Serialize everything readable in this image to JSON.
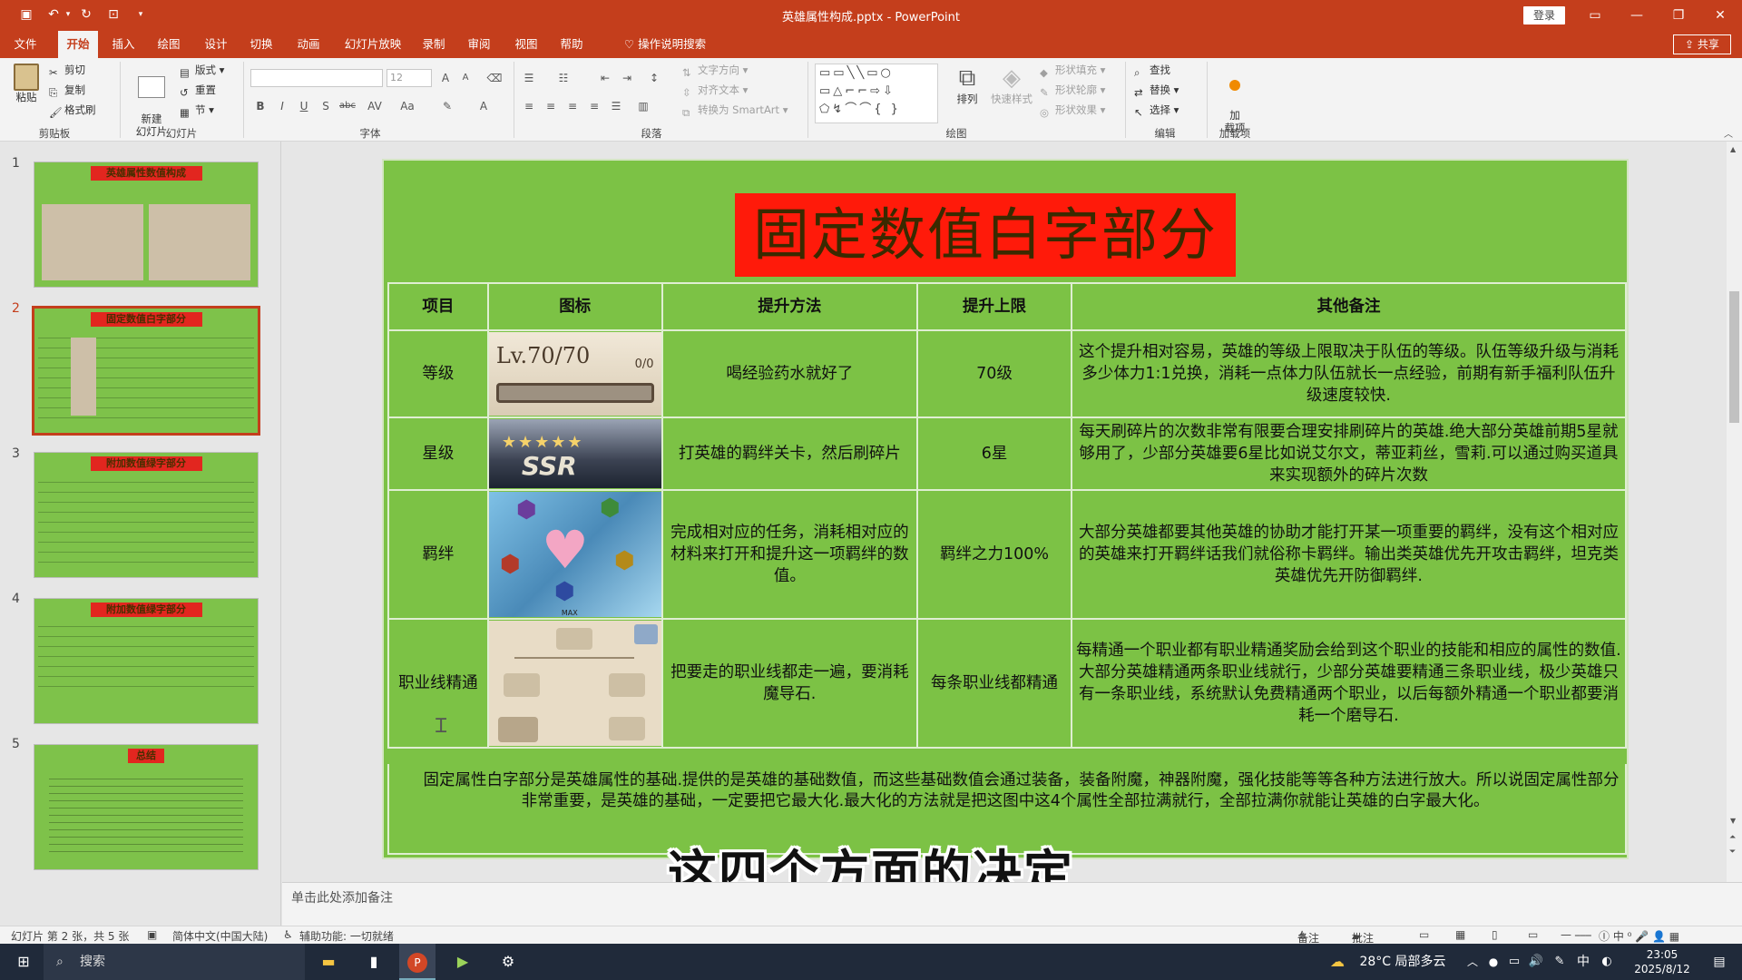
{
  "window": {
    "title": "英雄属性构成.pptx  -  PowerPoint",
    "login_label": "登录",
    "share_label": "共享"
  },
  "tabs": [
    "文件",
    "开始",
    "插入",
    "绘图",
    "设计",
    "切换",
    "动画",
    "幻灯片放映",
    "录制",
    "审阅",
    "视图",
    "帮助"
  ],
  "tell_me": "操作说明搜索",
  "ribbon": {
    "clipboard": {
      "label": "剪贴板",
      "paste": "粘贴",
      "cut": "剪切",
      "copy": "复制",
      "format_painter": "格式刷"
    },
    "slides": {
      "label": "幻灯片",
      "new_slide": "新建\n幻灯片",
      "layout": "版式",
      "reset": "重置",
      "section": "节"
    },
    "font": {
      "label": "字体",
      "size": "12"
    },
    "paragraph": {
      "label": "段落",
      "text_direction": "文字方向",
      "align_text": "对齐文本",
      "smartart": "转换为 SmartArt"
    },
    "drawing": {
      "label": "绘图",
      "arrange": "排列",
      "quick_styles": "快速样式",
      "shape_fill": "形状填充",
      "shape_outline": "形状轮廓",
      "shape_effects": "形状效果"
    },
    "editing": {
      "label": "编辑",
      "find": "查找",
      "replace": "替换",
      "select": "选择"
    },
    "addins": {
      "label": "加载项",
      "button": "加\n载项"
    }
  },
  "thumbnails": [
    {
      "num": "1",
      "title": "英雄属性数值构成"
    },
    {
      "num": "2",
      "title": "固定数值白字部分"
    },
    {
      "num": "3",
      "title": "附加数值绿字部分"
    },
    {
      "num": "4",
      "title": "附加数值绿字部分"
    },
    {
      "num": "5",
      "title": "总结"
    }
  ],
  "slide": {
    "title": "固定数值白字部分",
    "headers": [
      "项目",
      "图标",
      "提升方法",
      "提升上限",
      "其他备注"
    ],
    "rows": [
      {
        "item": "等级",
        "icon_text": "Lv.70/70",
        "icon_sub": "0/0",
        "method": "喝经验药水就好了",
        "limit": "70级",
        "note": "这个提升相对容易，英雄的等级上限取决于队伍的等级。队伍等级升级与消耗多少体力1:1兑换，消耗一点体力队伍就长一点经验，前期有新手福利队伍升级速度较快."
      },
      {
        "item": "星级",
        "icon_text": "SSR",
        "method": "打英雄的羁绊关卡，然后刷碎片",
        "limit": "6星",
        "note": "每天刷碎片的次数非常有限要合理安排刷碎片的英雄.绝大部分英雄前期5星就够用了，少部分英雄要6星比如说艾尔文，蒂亚莉丝，雪莉.可以通过购买道具来实现额外的碎片次数"
      },
      {
        "item": "羁绊",
        "icon_text": "MAX",
        "method": "完成相对应的任务，消耗相对应的材料来打开和提升这一项羁绊的数值。",
        "limit": "羁绊之力100%",
        "note": "大部分英雄都要其他英雄的协助才能打开某一项重要的羁绊，没有这个相对应的英雄来打开羁绊话我们就俗称卡羁绊。输出类英雄优先开攻击羁绊，坦克类英雄优先开防御羁绊."
      },
      {
        "item": "职业线精通",
        "icon_text": "",
        "method": "把要走的职业线都走一遍，要消耗魔导石.",
        "limit": "每条职业线都精通",
        "note": "每精通一个职业都有职业精通奖励会给到这个职业的技能和相应的属性的数值.大部分英雄精通两条职业线就行，少部分英雄要精通三条职业线，极少英雄只有一条职业线，系统默认免费精通两个职业，以后每额外精通一个职业都要消耗一个磨导石."
      }
    ],
    "summary": "固定属性白字部分是英雄属性的基础.提供的是英雄的基础数值，而这些基础数值会通过装备，装备附魔，神器附魔，强化技能等等各种方法进行放大。所以说固定属性部分非常重要，是英雄的基础，一定要把它最大化.最大化的方法就是把这图中这4个属性全部拉满就行，全部拉满你就能让英雄的白字最大化。"
  },
  "caption": "这四个方面的决定",
  "notes_placeholder": "单击此处添加备注",
  "status": {
    "slide_info": "幻灯片 第 2 张，共 5 张",
    "language": "简体中文(中国大陆)",
    "accessibility": "辅助功能: 一切就绪",
    "notes": "备注",
    "comments": "批注"
  },
  "taskbar": {
    "search": "搜索",
    "weather": "28°C  局部多云",
    "ime": "中",
    "time": "23:05",
    "date": "2025/8/12"
  },
  "colors": {
    "accent": "#c43e1c",
    "slide_bg": "#7cc245",
    "title_red": "#ff1a0a"
  }
}
